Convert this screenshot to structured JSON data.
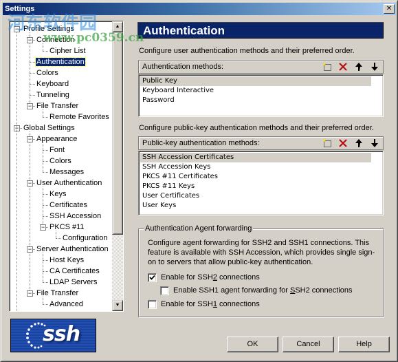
{
  "window": {
    "title": "Settings",
    "close_label": "✕"
  },
  "tree": {
    "items": [
      {
        "label": "Profile Settings",
        "level": 0,
        "expander": "−",
        "selected": false
      },
      {
        "label": "Connection",
        "level": 1,
        "expander": "−",
        "selected": false
      },
      {
        "label": "Cipher List",
        "level": 2,
        "expander": null,
        "selected": false
      },
      {
        "label": "Authentication",
        "level": 1,
        "expander": null,
        "selected": true
      },
      {
        "label": "Colors",
        "level": 1,
        "expander": null,
        "selected": false
      },
      {
        "label": "Keyboard",
        "level": 1,
        "expander": null,
        "selected": false
      },
      {
        "label": "Tunneling",
        "level": 1,
        "expander": null,
        "selected": false
      },
      {
        "label": "File Transfer",
        "level": 1,
        "expander": "−",
        "selected": false
      },
      {
        "label": "Remote Favorites",
        "level": 2,
        "expander": null,
        "selected": false
      },
      {
        "label": "Global Settings",
        "level": 0,
        "expander": "−",
        "selected": false
      },
      {
        "label": "Appearance",
        "level": 1,
        "expander": "−",
        "selected": false
      },
      {
        "label": "Font",
        "level": 2,
        "expander": null,
        "selected": false
      },
      {
        "label": "Colors",
        "level": 2,
        "expander": null,
        "selected": false
      },
      {
        "label": "Messages",
        "level": 2,
        "expander": null,
        "selected": false
      },
      {
        "label": "User Authentication",
        "level": 1,
        "expander": "−",
        "selected": false
      },
      {
        "label": "Keys",
        "level": 2,
        "expander": null,
        "selected": false
      },
      {
        "label": "Certificates",
        "level": 2,
        "expander": null,
        "selected": false
      },
      {
        "label": "SSH Accession",
        "level": 2,
        "expander": null,
        "selected": false
      },
      {
        "label": "PKCS #11",
        "level": 2,
        "expander": "−",
        "selected": false
      },
      {
        "label": "Configuration",
        "level": 3,
        "expander": null,
        "selected": false
      },
      {
        "label": "Server Authentication",
        "level": 1,
        "expander": "−",
        "selected": false
      },
      {
        "label": "Host Keys",
        "level": 2,
        "expander": null,
        "selected": false
      },
      {
        "label": "CA Certificates",
        "level": 2,
        "expander": null,
        "selected": false
      },
      {
        "label": "LDAP Servers",
        "level": 2,
        "expander": null,
        "selected": false
      },
      {
        "label": "File Transfer",
        "level": 1,
        "expander": "−",
        "selected": false
      },
      {
        "label": "Advanced",
        "level": 2,
        "expander": null,
        "selected": false
      }
    ],
    "scroll_up": "▲",
    "scroll_down": "▼"
  },
  "page": {
    "title": "Authentication",
    "auth_description": "Configure user authentication methods and their preferred order.",
    "auth_methods_header": "Authentication methods:",
    "auth_methods": [
      "Public Key",
      "Keyboard Interactive",
      "Password"
    ],
    "auth_methods_selected": 0,
    "pk_description": "Configure public-key authentication methods and their preferred order.",
    "pk_methods_header": "Public-key authentication methods:",
    "pk_methods": [
      "SSH Accession Certificates",
      "SSH Accession Keys",
      "PKCS #11 Certificates",
      "PKCS #11 Keys",
      "User Certificates",
      "User Keys"
    ],
    "pk_methods_selected": 0,
    "toolbar": {
      "add_icon": "new-item-icon",
      "delete_icon": "delete-x-icon",
      "up_icon": "arrow-up-icon",
      "down_icon": "arrow-down-icon"
    },
    "agent_forwarding": {
      "title": "Authentication Agent forwarding",
      "description": "Configure agent forwarding for SSH2 and SSH1 connections. This feature is available with SSH Accession, which provides single sign-on to servers that allow public-key authentication.",
      "ssh2": {
        "pre": "Enable for SSH",
        "u": "2",
        "post": " connections",
        "checked": true
      },
      "ssh1_for_ssh2": {
        "pre": "Enable SSH1 agent forwarding for ",
        "u": "S",
        "post": "SH2 connections",
        "checked": false
      },
      "ssh1": {
        "pre": "Enable for SSH",
        "u": "1",
        "post": " connections",
        "checked": false
      }
    }
  },
  "logo": {
    "text": "ssh"
  },
  "buttons": {
    "ok": "OK",
    "cancel": "Cancel",
    "help": "Help"
  },
  "watermark": {
    "line1": "河东软件园",
    "line2": "www.pc0359.cn"
  },
  "colors": {
    "header_bg": "#0a246a",
    "selection": "#0a246a",
    "delete": "#b01010"
  }
}
